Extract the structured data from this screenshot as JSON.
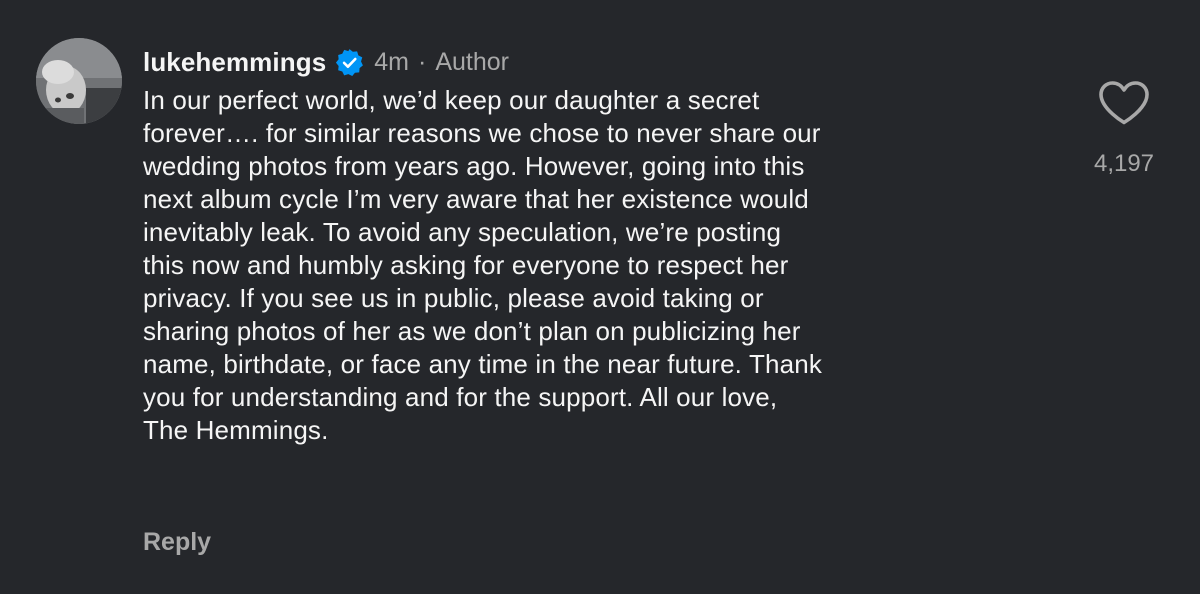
{
  "comment": {
    "username": "lukehemmings",
    "verified_icon": "verified-badge-icon",
    "timestamp": "4m",
    "separator": "·",
    "author_label": "Author",
    "text_lines": [
      "In our perfect world, we’d keep our daughter a secret",
      "forever…. for similar reasons we chose to never share our",
      "wedding photos from years ago. However, going into this",
      "next album cycle I’m very aware that her existence would",
      "inevitably leak. To avoid any speculation, we’re posting",
      "this now and humbly asking for everyone to respect her",
      "privacy. If you see us in public, please avoid taking or",
      "sharing photos of her as we don’t plan on publicizing her",
      "name, birthdate, or face any time in the near future. Thank",
      "you for understanding and for the support. All our love,",
      "The Hemmings."
    ],
    "reply_label": "Reply",
    "like_icon": "heart-outline-icon",
    "like_count": "4,197"
  },
  "colors": {
    "background": "#25272b",
    "primary_text": "#f5f5f5",
    "secondary_text": "#a8a8a8",
    "verified_blue": "#0095f6"
  }
}
